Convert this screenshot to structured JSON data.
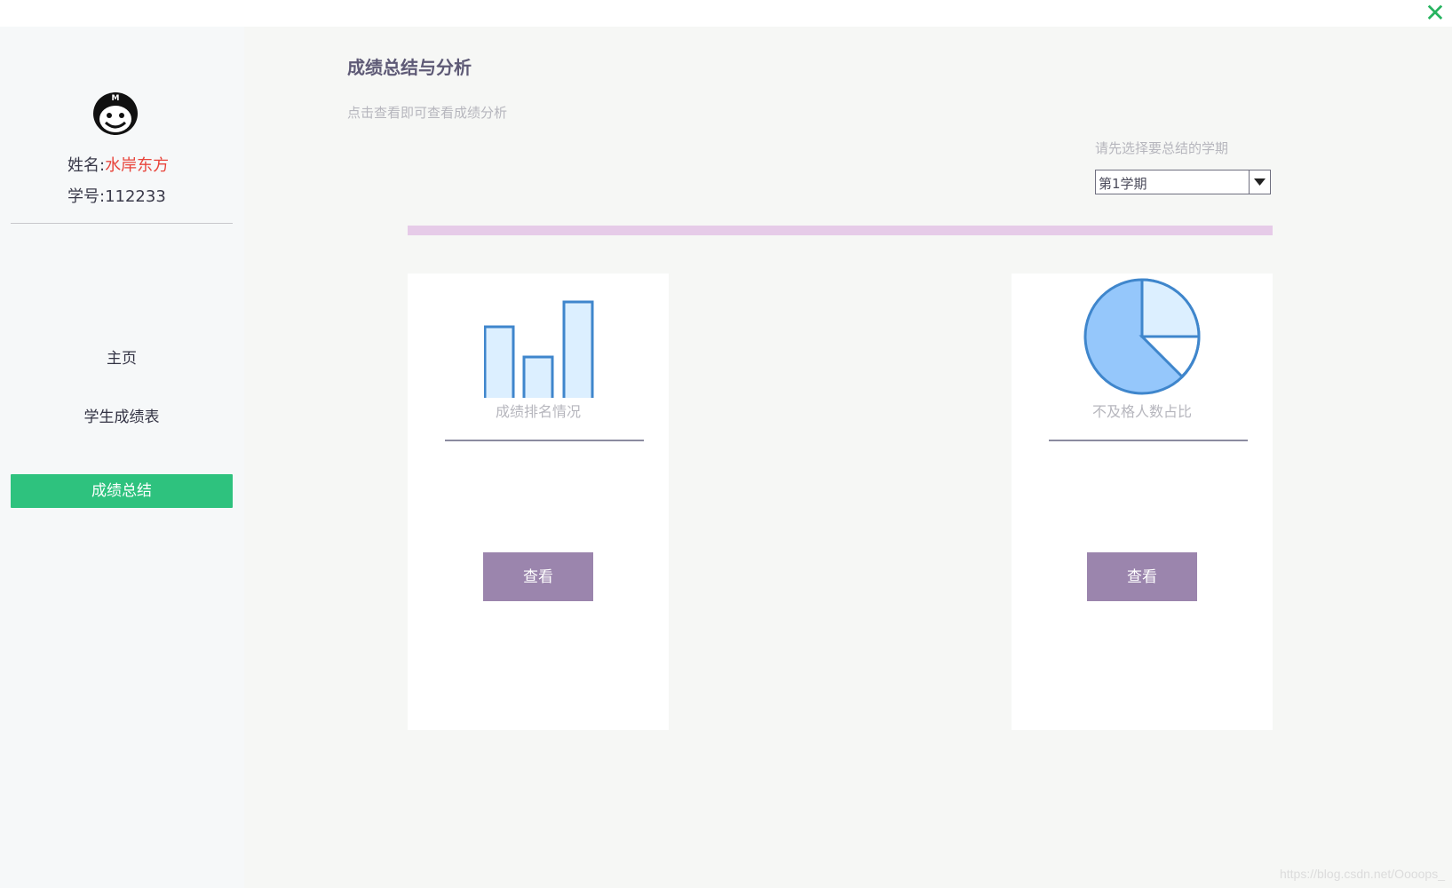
{
  "window": {
    "close_icon": "close-icon"
  },
  "sidebar": {
    "name_label": "姓名:",
    "name_value": "水岸东方",
    "id_label": "学号:",
    "id_value": "112233",
    "items": [
      {
        "label": "主页",
        "active": false
      },
      {
        "label": "学生成绩表",
        "active": false
      },
      {
        "label": "成绩总结",
        "active": true
      }
    ],
    "accent_color": "#2ec27e"
  },
  "main": {
    "title": "成绩总结与分析",
    "subtitle": "点击查看即可查看成绩分析",
    "term_prompt": "请先选择要总结的学期",
    "term_selected": "第1学期",
    "cards": [
      {
        "label": "成绩排名情况",
        "icon": "bar-chart-icon",
        "button_label": "查看"
      },
      {
        "label": "不及格人数占比",
        "icon": "pie-chart-icon",
        "button_label": "查看"
      }
    ],
    "button_color": "#9b85ad"
  },
  "watermark": "https://blog.csdn.net/Oooops_"
}
